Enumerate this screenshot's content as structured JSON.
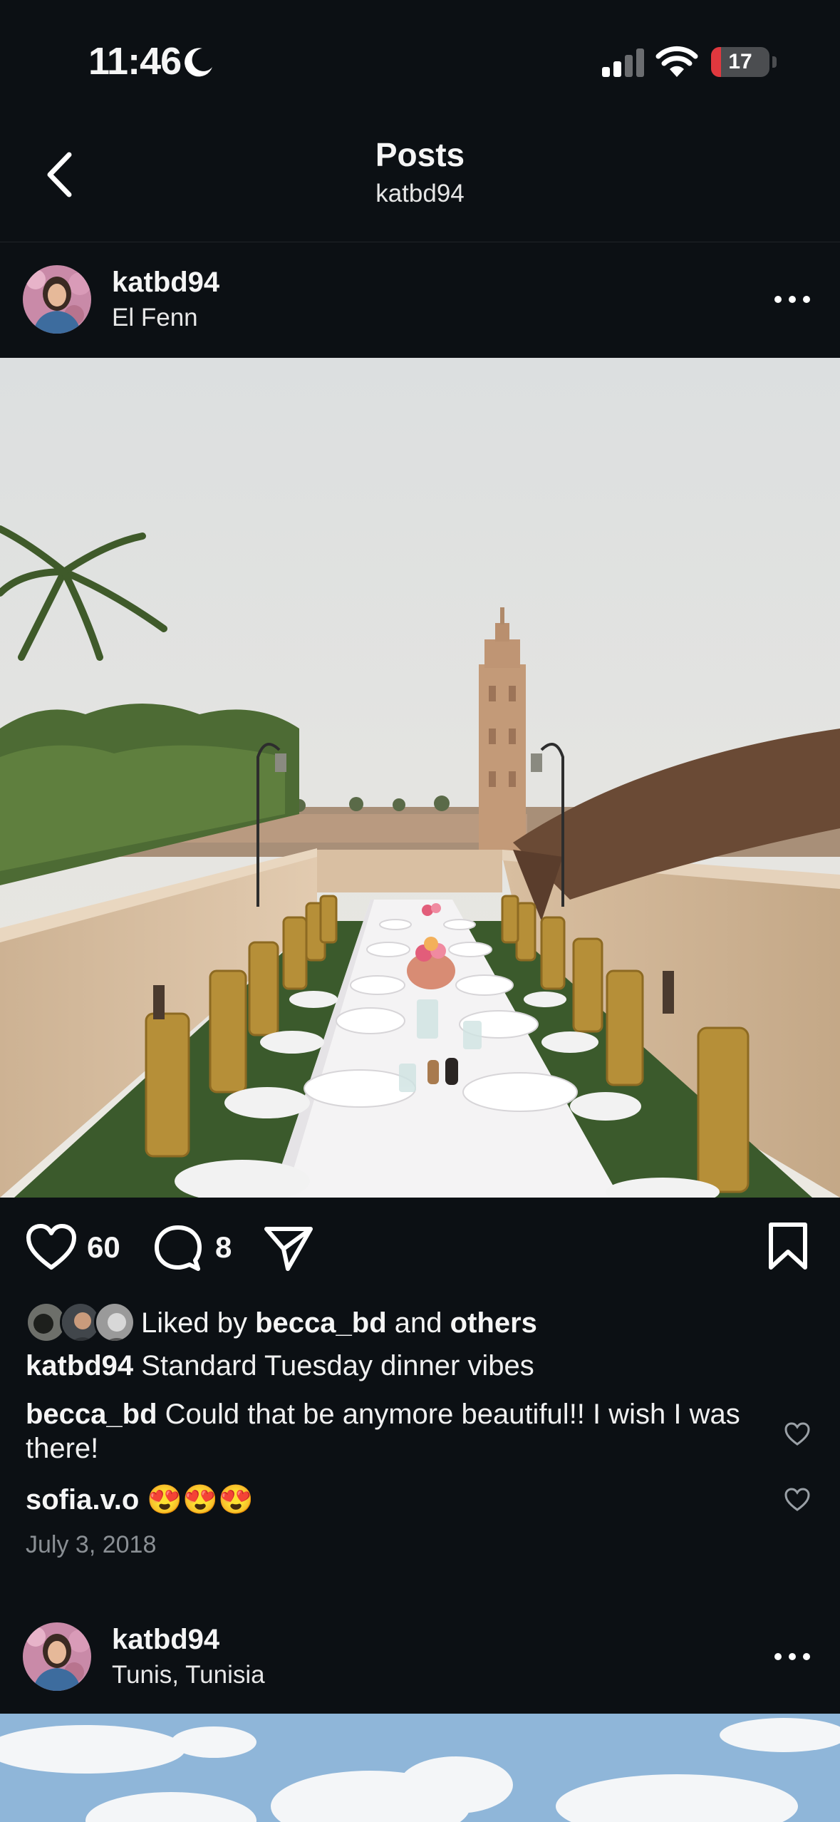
{
  "status_bar": {
    "time": "11:46",
    "battery_level": "17",
    "battery_fraction": 0.17,
    "colors": {
      "battery_low": "#e0383e"
    },
    "icons": [
      "moon-icon",
      "cellular-signal-icon",
      "wifi-icon",
      "battery-icon"
    ]
  },
  "nav": {
    "title": "Posts",
    "subtitle": "katbd94",
    "icons": [
      "back-chevron-icon"
    ]
  },
  "posts": [
    {
      "username": "katbd94",
      "location": "El Fenn",
      "photo_description_icon": "rooftop-dinner-photo",
      "likes_count": "60",
      "comments_count": "8",
      "liked_by_prefix": "Liked by",
      "liked_by_user": "becca_bd",
      "liked_by_and": "and",
      "liked_by_others": "others",
      "caption_user": "katbd94",
      "caption_text": "Standard Tuesday dinner vibes",
      "comments": [
        {
          "user": "becca_bd",
          "text": "Could that be anymore beautiful!! I wish I was there!"
        },
        {
          "user": "sofia.v.o",
          "text": "😍😍😍"
        }
      ],
      "date": "July 3, 2018"
    },
    {
      "username": "katbd94",
      "location": "Tunis, Tunisia"
    }
  ],
  "colors": {
    "background": "#0c1014",
    "text": "#f5f5f5",
    "muted": "#8a8f94"
  }
}
